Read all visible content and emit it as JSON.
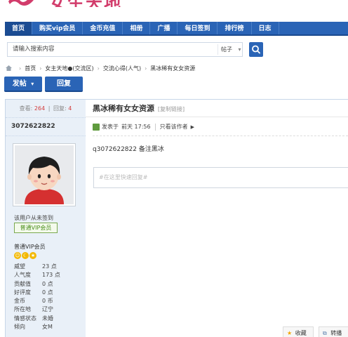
{
  "site": {
    "logo_text": "女生天地"
  },
  "nav": [
    {
      "label": "首页",
      "active": true
    },
    {
      "label": "购买vip会员",
      "active": false
    },
    {
      "label": "金币充值",
      "active": false
    },
    {
      "label": "相册",
      "active": false
    },
    {
      "label": "广播",
      "active": false
    },
    {
      "label": "每日签到",
      "active": false
    },
    {
      "label": "排行榜",
      "active": false
    },
    {
      "label": "日志",
      "active": false
    }
  ],
  "search": {
    "placeholder": "请输入搜索内容",
    "type_label": "帖子",
    "type_arrow": "▾"
  },
  "breadcrumb": [
    "首页",
    "女主天地●(交流区)",
    "交流心得(人气)",
    "黑冰稀有女女资源"
  ],
  "actions": {
    "post_label": "发帖",
    "post_arrow": "▾",
    "reply_label": "回复"
  },
  "stats": {
    "views_label": "查看:",
    "views": "264",
    "sep": "|",
    "replies_label": "回复:",
    "replies": "4"
  },
  "author": {
    "name": "3072622822",
    "signin_note": "该用户从未签到",
    "vip_badge": "普通VIP会员",
    "group": "普通VIP会员",
    "props": [
      {
        "name": "威望",
        "value": "23 点"
      },
      {
        "name": "人气度",
        "value": "173 点"
      },
      {
        "name": "贡献值",
        "value": "0 点"
      },
      {
        "name": "好评度",
        "value": "0 点"
      },
      {
        "name": "金币",
        "value": "0 币"
      },
      {
        "name": "所在地",
        "value": "辽宁"
      },
      {
        "name": "情感状态",
        "value": "未婚"
      },
      {
        "name": "倾向",
        "value": "女M"
      }
    ]
  },
  "post": {
    "title": "黑冰稀有女女资源",
    "copy_link": "[复制链接]",
    "posted_label": "发表于",
    "posted_time": "前天 17:56",
    "only_author": "只看该作者",
    "only_author_arrow": "▶",
    "body": "q3072622822  备注黑冰",
    "quick_reply_placeholder": "#在这里快速回复#"
  },
  "bottom": {
    "favorite": "收藏",
    "share": "转播"
  },
  "colors": {
    "nav_blue": "#2a64b6",
    "brand_pink": "#d23c6b"
  }
}
